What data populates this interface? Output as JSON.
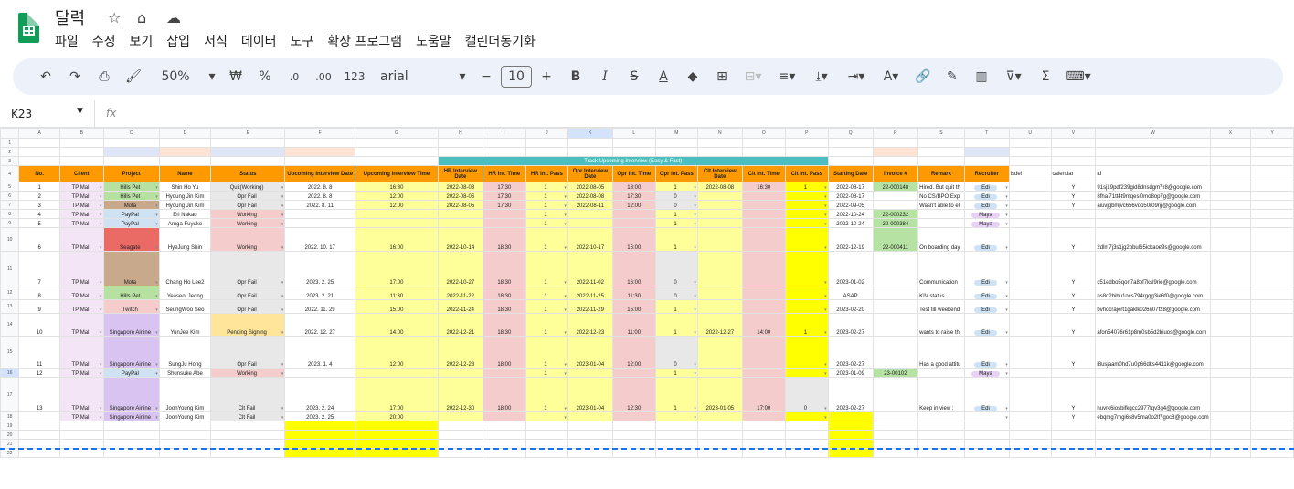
{
  "doc": {
    "title": "달력",
    "menu": [
      "파일",
      "수정",
      "보기",
      "삽입",
      "서식",
      "데이터",
      "도구",
      "확장 프로그램",
      "도움말",
      "캘린더동기화"
    ]
  },
  "toolbar": {
    "zoom": "50%",
    "currency": "₩",
    "percent": "%",
    "dec_less": ".0",
    "dec_more": ".00",
    "numfmt": "123",
    "font": "arial",
    "font_size": "10"
  },
  "formula": {
    "cell": "K23",
    "fx": "fx"
  },
  "cols": [
    "",
    "A",
    "B",
    "C",
    "D",
    "E",
    "F",
    "G",
    "H",
    "I",
    "J",
    "K",
    "L",
    "M",
    "N",
    "O",
    "P",
    "Q",
    "R",
    "S",
    "T",
    "U",
    "V",
    "W",
    "X",
    "Y"
  ],
  "header": [
    "No.",
    "Client",
    "Project",
    "Name",
    "Status",
    "Upcoming Interview Date",
    "Upcoming Interview Time",
    "HR Interview Date",
    "HR Int. Time",
    "HR Int. Pass",
    "Opr Interview Date",
    "Opr Int. Time",
    "Opr Int. Pass",
    "Clt Interview Date",
    "Clt Int. Time",
    "Clt Int. Pass",
    "Starting Date",
    "Invoice #",
    "Remark",
    "Recruiter",
    "isdel",
    "calendar",
    "id",
    "",
    ""
  ],
  "row3_banner": "Track Upcoming Interview (Easy & Fast)",
  "rows": [
    [
      "1",
      "TP Mal",
      "Hills Pet",
      "Shin Ho Yu",
      "Quit(Working)",
      "2022. 8. 8",
      "16:30",
      "2022-08-03",
      "17:30",
      "1",
      "2022-08-05",
      "18:00",
      "1",
      "2022-08-08",
      "16:30",
      "1",
      "2022-08-17",
      "22-000148",
      "Hired. But quit th",
      "Edi",
      "",
      "Y",
      "91sj19pdf239gid8dnsdgm7r8@google.com"
    ],
    [
      "2",
      "TP Mal",
      "Hills Pet",
      "Hyoung Jin Kim",
      "Opr Fail",
      "2022. 8. 8",
      "12:00",
      "2022-08-05",
      "17:30",
      "1",
      "2022-08-08",
      "17:30",
      "0",
      "",
      "",
      "",
      "2022-08-17",
      "",
      "No CS/BPO Exp",
      "Edi",
      "",
      "Y",
      "8fhai71tt4t9mqesl0mo8op7g@google.com"
    ],
    [
      "3",
      "TP Mal",
      "Mota",
      "Hyoung Jin Kim",
      "Opr Fail",
      "2022. 8. 11",
      "12:00",
      "2022-08-05",
      "17:30",
      "1",
      "2022-08-11",
      "12:00",
      "0",
      "",
      "",
      "",
      "2022-09-05",
      "",
      "Wasn't able to el",
      "Edi",
      "",
      "Y",
      "aiuvjgbmjvc656vdo50r09rg@google.com"
    ],
    [
      "4",
      "TP Mal",
      "PayPal",
      "Eri Nakao",
      "Working",
      "",
      "",
      "",
      "",
      "1",
      "",
      "",
      "1",
      "",
      "",
      "",
      "2022-10-24",
      "22-000232",
      "",
      "Maya",
      "",
      "",
      ""
    ],
    [
      "5",
      "TP Mal",
      "PayPal",
      "Aruga Fuyuko",
      "Working",
      "",
      "",
      "",
      "",
      "1",
      "",
      "",
      "1",
      "",
      "",
      "",
      "2022-10-24",
      "22-000384",
      "",
      "Maya",
      "",
      "",
      ""
    ],
    [
      "6",
      "TP Mal",
      "Seagate",
      "HyeJung Shin",
      "Working",
      "2022. 10. 17",
      "16:00",
      "2022-10-14",
      "18:30",
      "1",
      "2022-10-17",
      "16:00",
      "1",
      "",
      "",
      "",
      "2022-12-19",
      "22-000411",
      "On boarding day",
      "Edi",
      "",
      "Y",
      "2dlm7j3s1jg2bbul65ickaoe9s@google.com"
    ],
    [
      "7",
      "TP Mal",
      "Mota",
      "Chang Ho Lee2",
      "Opr Fail",
      "2023. 2. 25",
      "17:00",
      "2022-10-27",
      "18:30",
      "1",
      "2022-11-02",
      "16:00",
      "0",
      "",
      "",
      "",
      "2023-01-02",
      "",
      "Communication",
      "Edi",
      "",
      "Y",
      "c51edbo5qon7a8of7ksl9rio@google.com"
    ],
    [
      "8",
      "TP Mal",
      "Hills Pet",
      "Yeaseol Jeong",
      "Opr Fail",
      "2023. 2. 21",
      "11:30",
      "2022-11-22",
      "18:30",
      "1",
      "2022-11-25",
      "11:30",
      "0",
      "",
      "",
      "",
      "ASAP",
      "",
      "KIV status.",
      "Edi",
      "",
      "Y",
      "ns8d2bibu1ocs794rgqg3ie6f0@google.com"
    ],
    [
      "9",
      "TP Mal",
      "Twitch",
      "SeungWoo Seo",
      "Opr Fail",
      "2022. 11. 29",
      "15:00",
      "2022-11-24",
      "18:30",
      "1",
      "2022-11-29",
      "15:00",
      "1",
      "",
      "",
      "",
      "2023-02-20",
      "",
      "Test till weekend",
      "Edi",
      "",
      "Y",
      "bvhqcrajert1gaklk026n07f28@google.com"
    ],
    [
      "10",
      "TP Mal",
      "Singapore Airline",
      "YunJee Kim",
      "Pending Signing",
      "2022. 12. 27",
      "14:00",
      "2022-12-21",
      "18:30",
      "1",
      "2022-12-23",
      "11:00",
      "1",
      "2022-12-27",
      "14:00",
      "1",
      "2023-02-27",
      "",
      "wants to raise th",
      "Edi",
      "",
      "Y",
      "afon54076r61p8m0sb5d2biuos@google.com"
    ],
    [
      "11",
      "TP Mal",
      "Singapore Airline",
      "SungJu Hong",
      "Opr Fail",
      "2023. 1. 4",
      "12:00",
      "2022-12-28",
      "18:00",
      "1",
      "2023-01-04",
      "12:00",
      "0",
      "",
      "",
      "",
      "2023-02-27",
      "",
      "Has a good attitu",
      "Edi",
      "",
      "Y",
      "i8usjaam0hd7u0p66dks4411k@google.com"
    ],
    [
      "12",
      "TP Mal",
      "PayPal",
      "Shunsuke Abe",
      "Working",
      "",
      "",
      "",
      "",
      "1",
      "",
      "",
      "1",
      "",
      "",
      "",
      "2023-01-09",
      "23-00102",
      "",
      "Maya",
      "",
      "",
      ""
    ],
    [
      "13",
      "TP Mal",
      "Singapore Airline",
      "JoonYoung Kim",
      "Clt Fail",
      "2023. 2. 24",
      "17:00",
      "2022-12-30",
      "18:00",
      "1",
      "2023-01-04",
      "12:30",
      "1",
      "2023-01-05",
      "17:00",
      "0",
      "2023-02-27",
      "",
      "Keep in view :",
      "Edi",
      "",
      "Y",
      "huvrk6iosbifkgcc2977fqv3g4@google.com"
    ],
    [
      "",
      "TP Mal",
      "Singapore Airline",
      "JoonYoung Kim",
      "Clt Fail",
      "2023. 2. 25",
      "20:00",
      "",
      "",
      "",
      "",
      "",
      "",
      "",
      "",
      "",
      "",
      "",
      "",
      "",
      "",
      "Y",
      "ebqmg7mgi6s8v5ma0o2lf7goc8@google.com"
    ]
  ],
  "colors": {
    "accent": "#0f9d58",
    "header_orange": "#ff9900",
    "teal": "#4bbfbf",
    "yellow": "#ffff99"
  }
}
